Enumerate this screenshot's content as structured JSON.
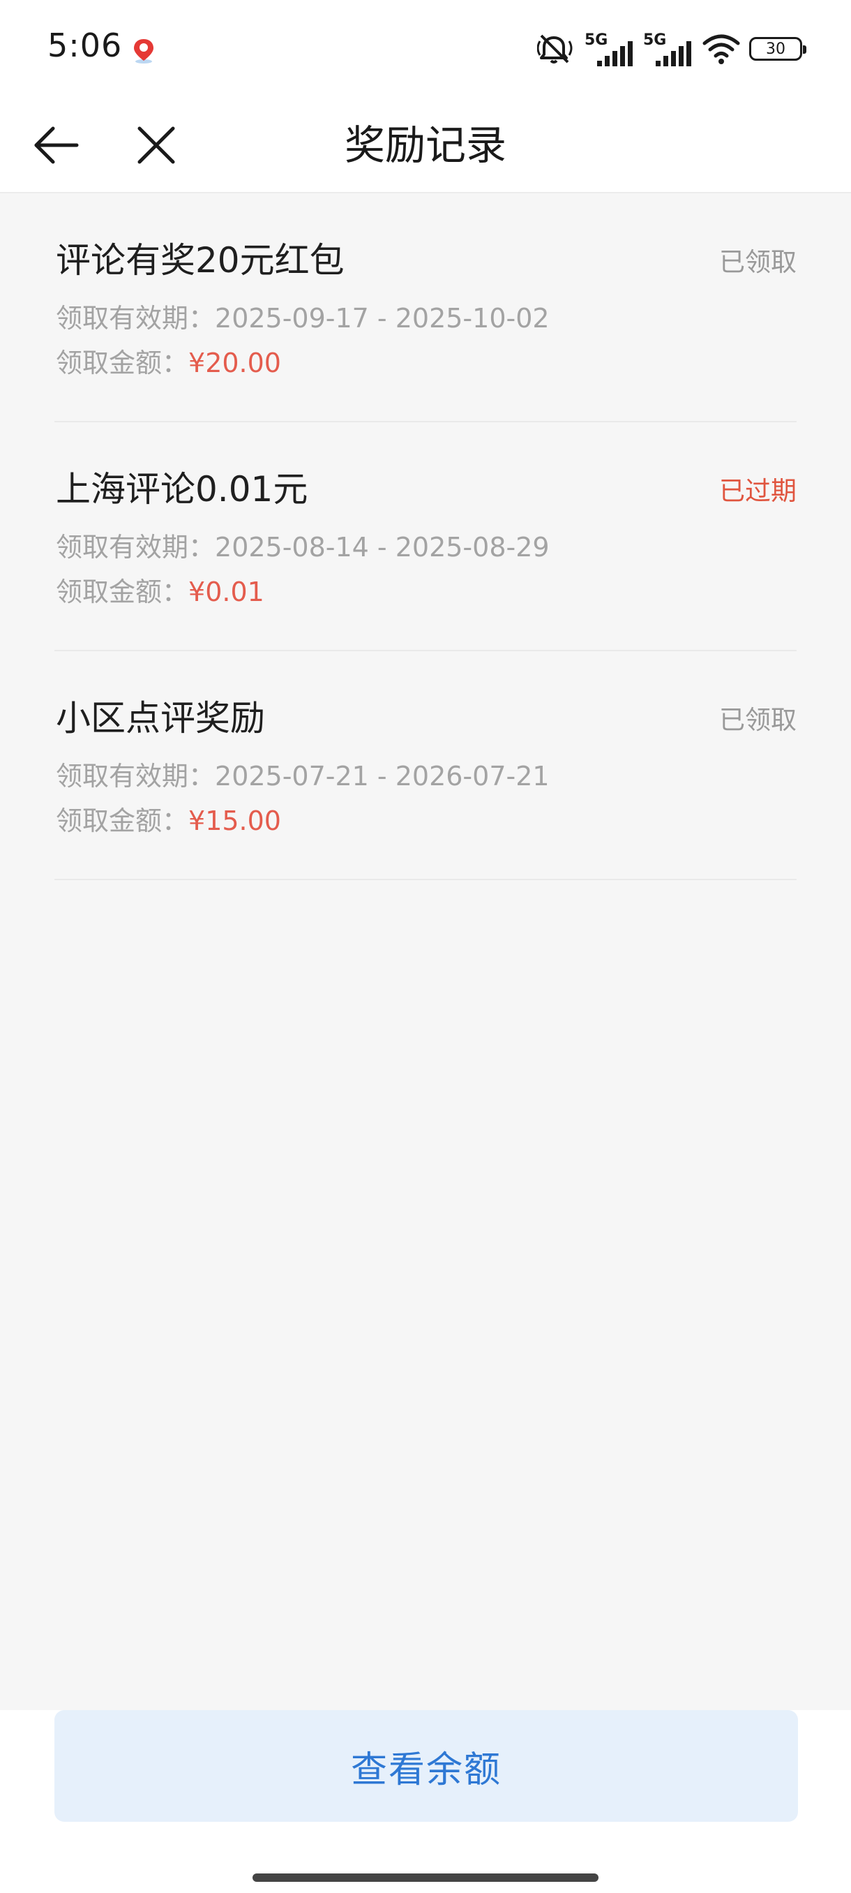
{
  "status_bar": {
    "time": "5:06",
    "app_icon": "map-pin-icon",
    "network_1": "5G",
    "network_2": "5G",
    "battery": "30",
    "icons": [
      "mute-icon",
      "signal-icon",
      "signal-icon",
      "wifi-icon",
      "battery-icon"
    ]
  },
  "nav": {
    "title": "奖励记录",
    "back_icon": "back-arrow-icon",
    "close_icon": "close-icon"
  },
  "records": [
    {
      "title": "评论有奖20元红包",
      "status": "已领取",
      "validity_label": "领取有效期：",
      "validity": "2025-09-17 - 2025-10-02",
      "amount_label": "领取金额：",
      "amount": "¥20.00"
    },
    {
      "title": "上海评论0.01元",
      "status": "已过期",
      "validity_label": "领取有效期：",
      "validity": "2025-08-14 - 2025-08-29",
      "amount_label": "领取金额：",
      "amount": "¥0.01"
    },
    {
      "title": "小区点评奖励",
      "status": "已领取",
      "validity_label": "领取有效期：",
      "validity": "2025-07-21 - 2026-07-21",
      "amount_label": "领取金额：",
      "amount": "¥15.00"
    }
  ],
  "footer": {
    "balance_button": "查看余额"
  },
  "colors": {
    "accent": "#2e78d4",
    "button_bg": "#e6f0fb",
    "amount": "#e45c4d",
    "expired": "#e0553f",
    "muted": "#999999"
  }
}
